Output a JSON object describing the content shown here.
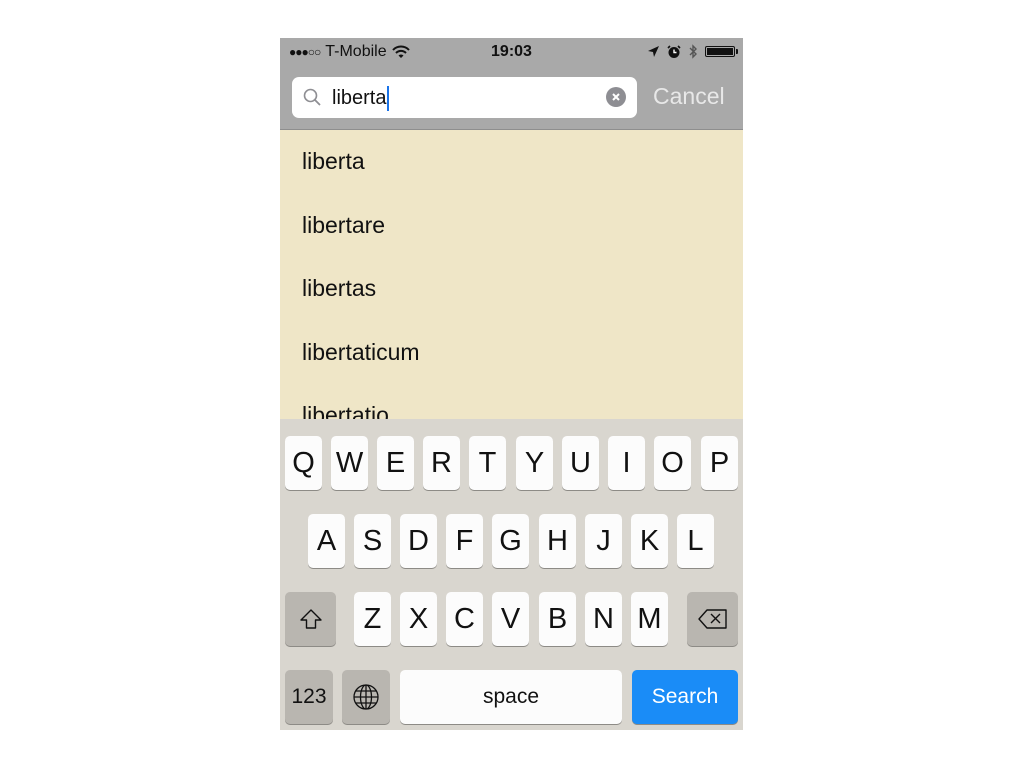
{
  "status_bar": {
    "signal": "●●●○○",
    "carrier": "T-Mobile",
    "time": "19:03"
  },
  "search": {
    "query": "liberta",
    "cancel_label": "Cancel"
  },
  "results": [
    "liberta",
    "libertare",
    "libertas",
    "libertaticum",
    "libertatio"
  ],
  "keyboard": {
    "row1": [
      "Q",
      "W",
      "E",
      "R",
      "T",
      "Y",
      "U",
      "I",
      "O",
      "P"
    ],
    "row2": [
      "A",
      "S",
      "D",
      "F",
      "G",
      "H",
      "J",
      "K",
      "L"
    ],
    "row3": [
      "Z",
      "X",
      "C",
      "V",
      "B",
      "N",
      "M"
    ],
    "numbers_label": "123",
    "space_label": "space",
    "search_label": "Search",
    "shift_icon": "shift-icon",
    "delete_icon": "delete-icon",
    "globe_icon": "globe-icon"
  },
  "colors": {
    "results_background": "#efe6c7",
    "header_background": "#a9a9a9",
    "search_key": "#1a8cf7"
  }
}
